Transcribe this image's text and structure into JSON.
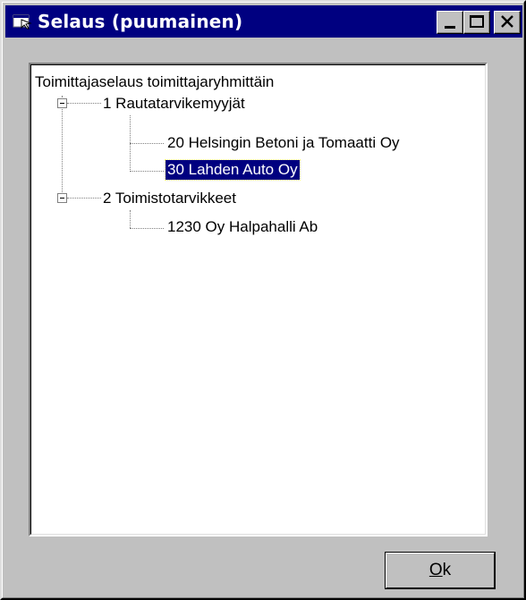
{
  "window": {
    "title": "Selaus (puumainen)",
    "icon": "app-window-icon",
    "title_color": "#000080"
  },
  "titlebar_buttons": [
    "minimize-icon",
    "maximize-icon",
    "close-icon"
  ],
  "tree": {
    "root": {
      "label": "Toimittajaselaus toimittajaryhmittäin"
    },
    "groups": [
      {
        "label": "1 Rautatarvikemyyjät",
        "expanded": true,
        "children": [
          {
            "label": "20 Helsingin Betoni ja Tomaatti Oy",
            "selected": false
          },
          {
            "label": "30 Lahden Auto Oy",
            "selected": true
          }
        ]
      },
      {
        "label": "2 Toimistotarvikkeet",
        "expanded": true,
        "children": [
          {
            "label": "1230 Oy Halpahalli Ab",
            "selected": false
          }
        ]
      }
    ],
    "selection_color": "#000080"
  },
  "ok_button": {
    "mnemonic": "O",
    "rest": "k"
  }
}
